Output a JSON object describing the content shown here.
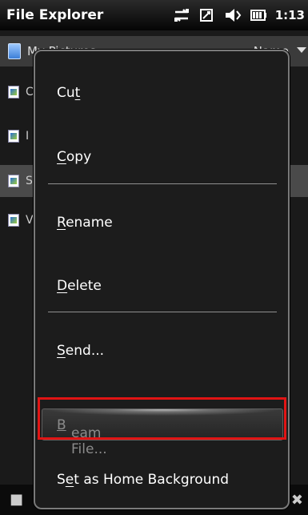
{
  "status_bar": {
    "app_title": "File Explorer",
    "time": "1:13",
    "icons": [
      "sync-icon",
      "signal-icon",
      "volume-icon",
      "battery-icon"
    ]
  },
  "background": {
    "path": "My Pictures",
    "sort": "Name",
    "files": [
      {
        "label": "C"
      },
      {
        "label": "I"
      },
      {
        "label": "S",
        "selected": true
      },
      {
        "label": "V"
      }
    ]
  },
  "menu": {
    "items": [
      {
        "pre": "Cu",
        "ul": "t",
        "post": ""
      },
      {
        "pre": "",
        "ul": "C",
        "post": "opy"
      },
      {
        "pre": "",
        "ul": "R",
        "post": "ename"
      },
      {
        "pre": "",
        "ul": "D",
        "post": "elete"
      },
      {
        "pre": "",
        "ul": "S",
        "post": "end..."
      },
      {
        "pre": "",
        "ul": "B",
        "post": "eam File...",
        "disabled": true
      },
      {
        "pre": "S",
        "ul": "e",
        "post": "t as Home Background"
      }
    ]
  },
  "colors": {
    "highlight": "#e11414"
  }
}
